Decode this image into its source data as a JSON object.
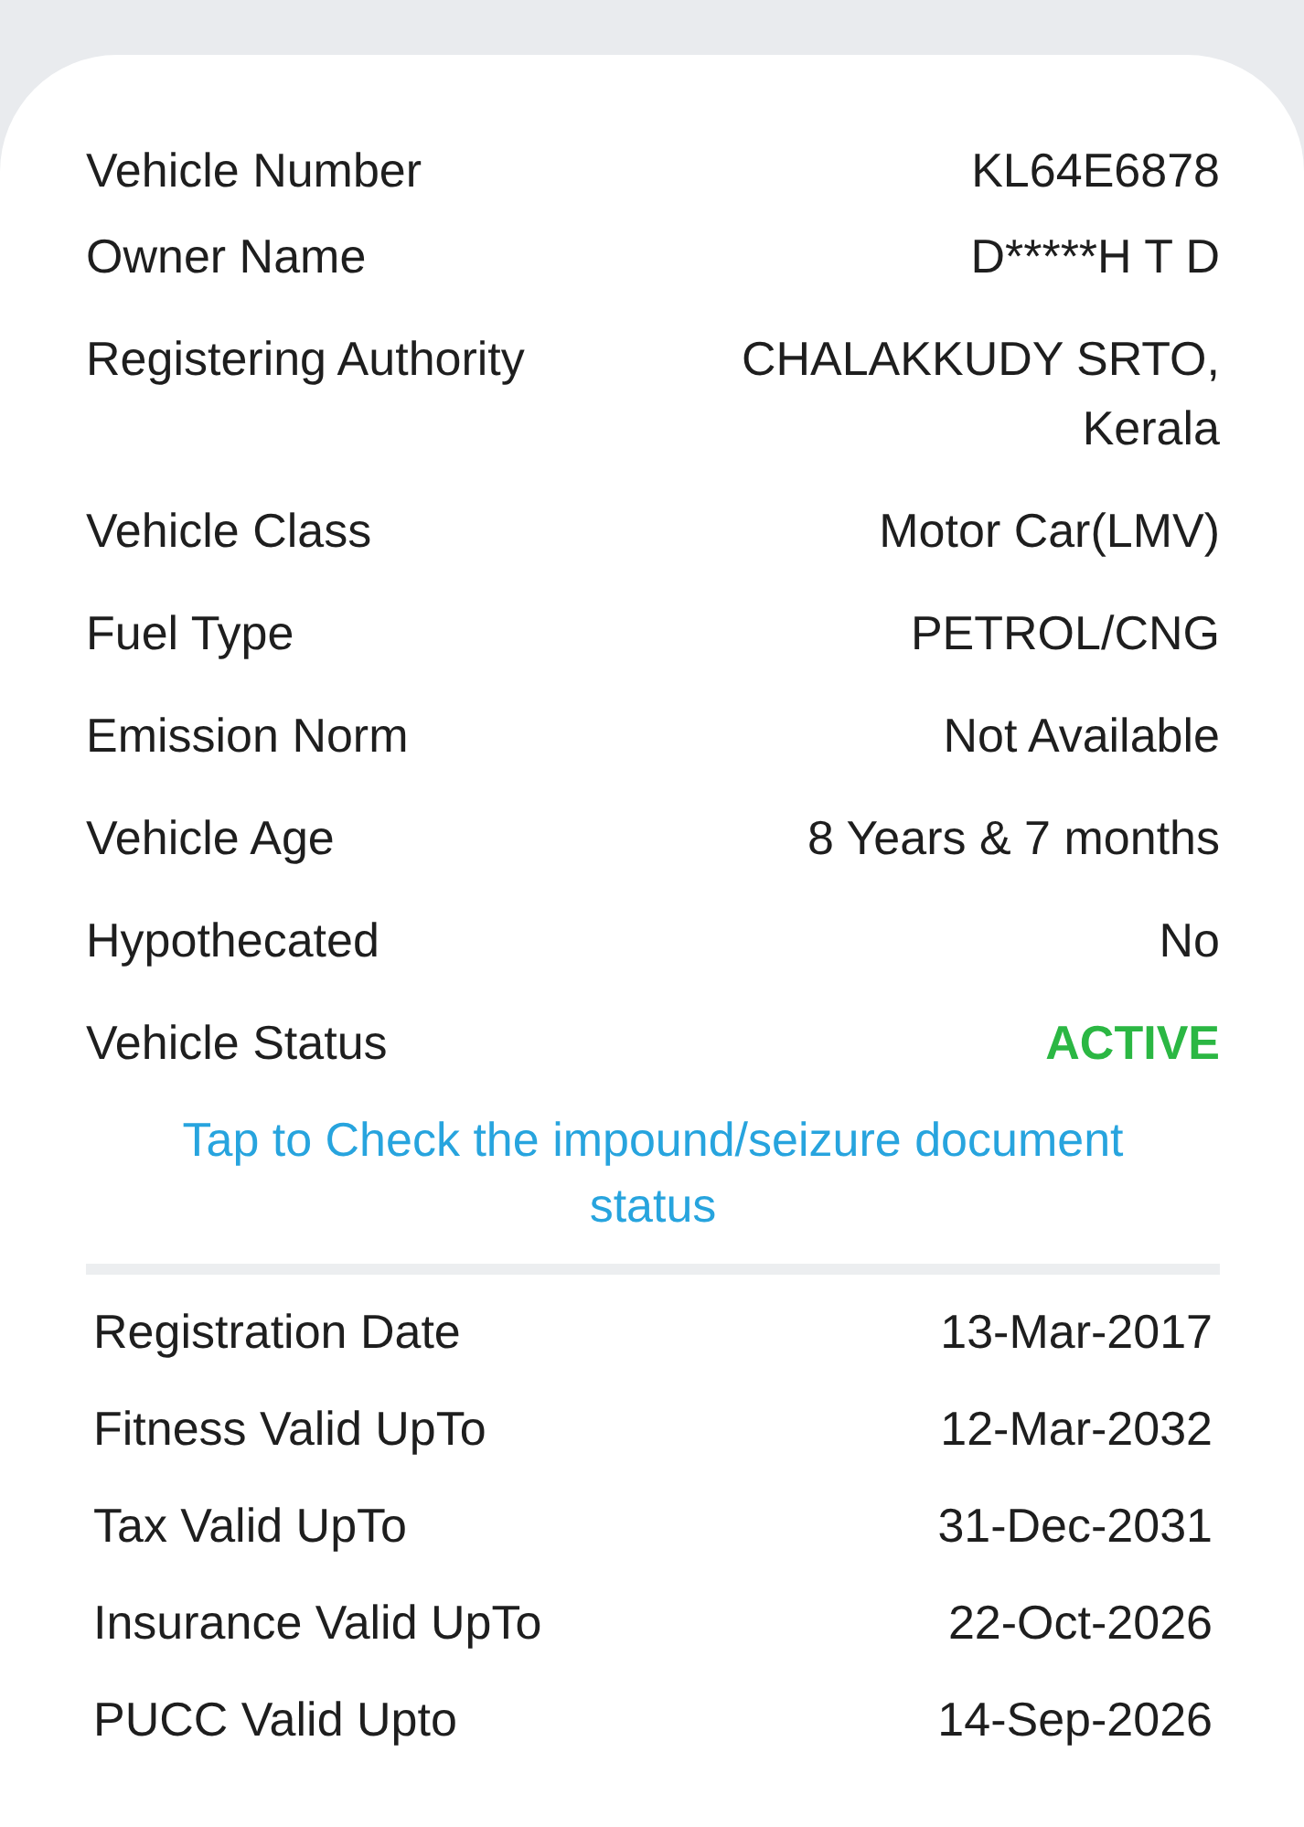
{
  "vehicle_details": [
    {
      "label": "Vehicle Number",
      "value": "KL64E6878",
      "kind": "text"
    },
    {
      "label": "Owner Name",
      "value": "D*****H T D",
      "kind": "text"
    },
    {
      "label": "Registering Authority",
      "value": "CHALAKKUDY SRTO,\nKerala",
      "kind": "text"
    },
    {
      "label": "Vehicle Class",
      "value": "Motor Car(LMV)",
      "kind": "text"
    },
    {
      "label": "Fuel Type",
      "value": "PETROL/CNG",
      "kind": "text"
    },
    {
      "label": "Emission Norm",
      "value": "Not Available",
      "kind": "text"
    },
    {
      "label": "Vehicle Age",
      "value": "8 Years  & 7 months",
      "kind": "text"
    },
    {
      "label": "Hypothecated",
      "value": "No",
      "kind": "text"
    },
    {
      "label": "Vehicle Status",
      "value": "ACTIVE",
      "kind": "status"
    }
  ],
  "impound_link": "Tap to Check the impound/seizure document status",
  "validity_dates": [
    {
      "label": "Registration Date",
      "value": "13-Mar-2017"
    },
    {
      "label": "Fitness Valid UpTo",
      "value": "12-Mar-2032"
    },
    {
      "label": "Tax Valid UpTo",
      "value": "31-Dec-2031"
    },
    {
      "label": "Insurance Valid UpTo",
      "value": "22-Oct-2026"
    },
    {
      "label": "PUCC Valid Upto",
      "value": "14-Sep-2026"
    }
  ]
}
